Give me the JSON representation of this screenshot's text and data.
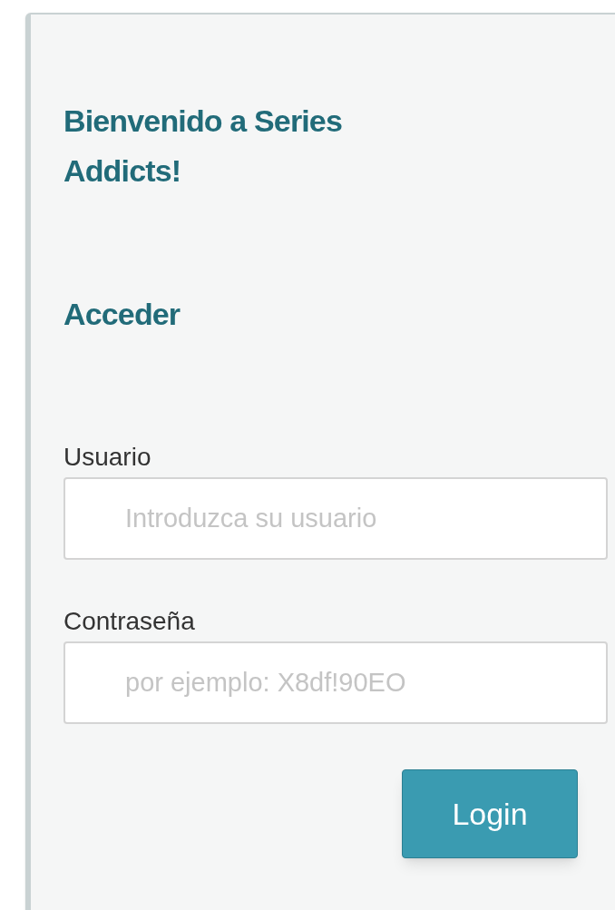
{
  "panel": {
    "title": "Bienvenido a Series Addicts!",
    "subtitle": "Acceder",
    "fields": [
      {
        "label": "Usuario",
        "placeholder": "Introduzca su usuario"
      },
      {
        "label": "Contraseña",
        "placeholder": "por ejemplo: X8df!90EO"
      }
    ],
    "button": "Login"
  }
}
